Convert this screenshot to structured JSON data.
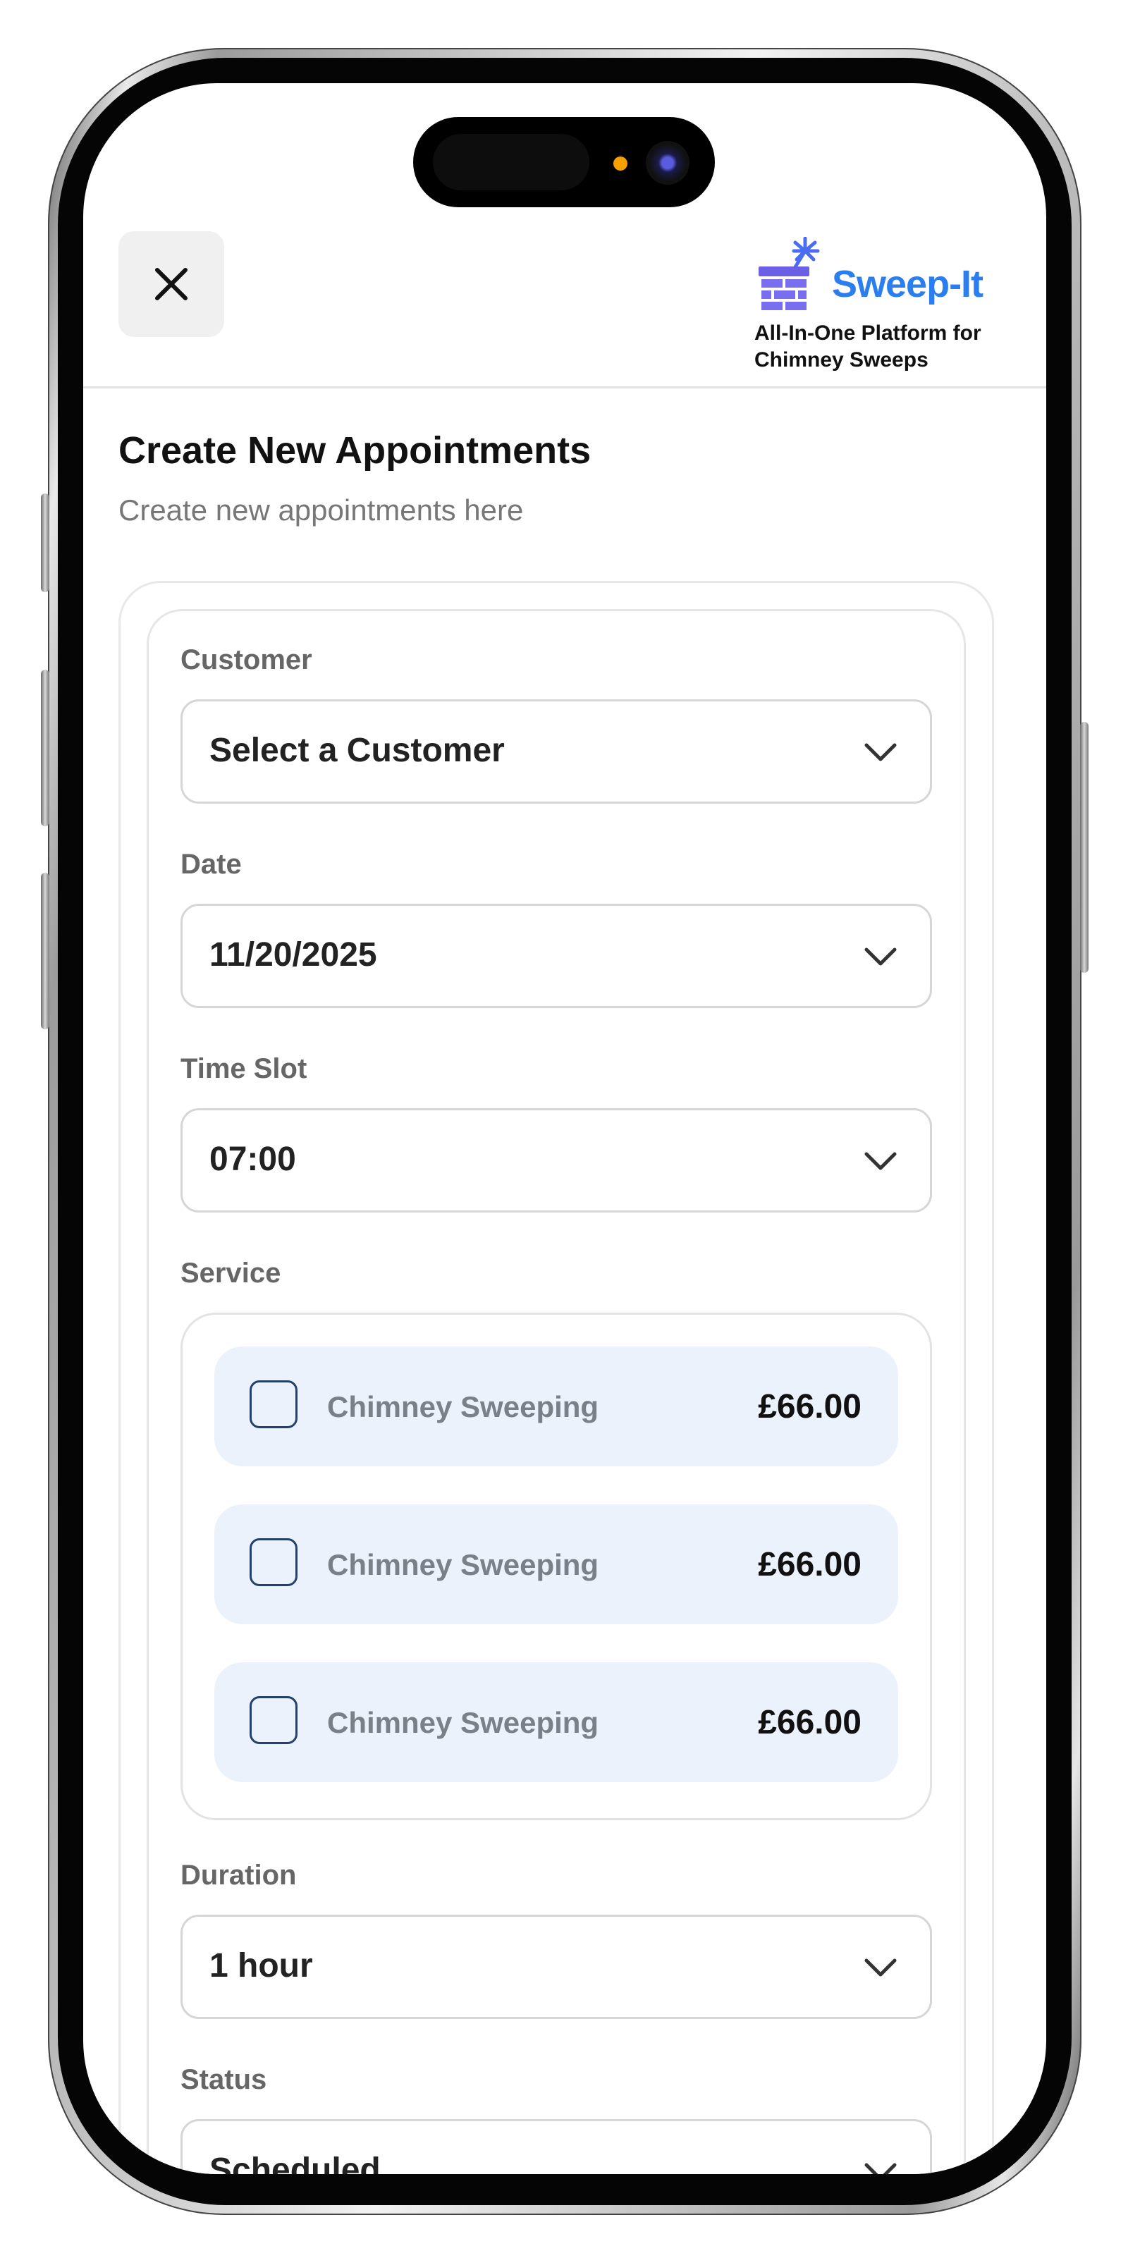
{
  "app": {
    "brand": "Sweep-It",
    "tagline_line1": "All-In-One Platform for",
    "tagline_line2": "Chimney Sweeps",
    "brand_color": "#2a7ef0",
    "logo_icon": "brick-chimney-with-brush-icon"
  },
  "header": {
    "close_icon": "close-icon"
  },
  "page": {
    "title": "Create New Appointments",
    "subtitle": "Create new appointments here"
  },
  "form": {
    "customer": {
      "label": "Customer",
      "value": "Select a Customer"
    },
    "date": {
      "label": "Date",
      "value": "11/20/2025"
    },
    "time_slot": {
      "label": "Time Slot",
      "value": "07:00"
    },
    "service": {
      "label": "Service",
      "items": [
        {
          "name": "Chimney Sweeping",
          "price": "£66.00",
          "checked": false
        },
        {
          "name": "Chimney Sweeping",
          "price": "£66.00",
          "checked": false
        },
        {
          "name": "Chimney Sweeping",
          "price": "£66.00",
          "checked": false
        }
      ]
    },
    "duration": {
      "label": "Duration",
      "value": "1 hour"
    },
    "status": {
      "label": "Status",
      "value": "Scheduled"
    }
  },
  "colors": {
    "service_item_bg": "#ecf2fc",
    "checkbox_border": "#23406e"
  }
}
